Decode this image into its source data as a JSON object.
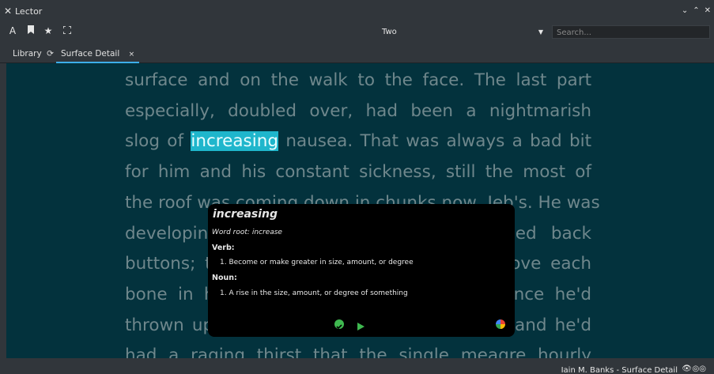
{
  "window": {
    "title": "Lector",
    "close_glyph": "✕",
    "chevrons": "⌄ ⌃ ✕"
  },
  "toolbar": {
    "icons": [
      "font-settings-icon",
      "bookmark-icon",
      "star-icon",
      "fullscreen-icon"
    ],
    "view_mode": "Two",
    "search_placeholder": "Search..."
  },
  "tabs": [
    {
      "label": "Library",
      "icon": "refresh-icon"
    },
    {
      "label": "Surface Detail",
      "closable": true
    }
  ],
  "reader": {
    "lines": [
      [
        "surface and on the walk to the face. The last part"
      ],
      [
        "especially, doubled over, had been a nightmarish"
      ],
      [
        "slog of ",
        "increasing",
        " nausea. That was always a bad bit"
      ],
      [
        "for him and his constant sickness, still the most of"
      ],
      [
        "the roof was coming down in chunks now, Jeb's. He was"
      ],
      [
        "developing terrible blisters on his so-called back"
      ],
      [
        "buttons; they felt as though they might move each"
      ],
      [
        "bone in his spine like giant warts. Ever since he'd"
      ],
      [
        "thrown up, his stomach had been rumbling and he'd"
      ],
      [
        "had a raging thirst that the single meagre hourly"
      ]
    ],
    "highlight_color": "#1fb6cc",
    "background_color": "#03323d"
  },
  "dictionary": {
    "word": "increasing",
    "root": "Word root: increase",
    "verb_label": "Verb:",
    "verb_def": "1. Become or make greater in size, amount, or degree",
    "noun_label": "Noun:",
    "noun_def": "1. A rise in the size, amount, or degree of something"
  },
  "status": {
    "text": "Iain M. Banks - Surface Detail"
  }
}
